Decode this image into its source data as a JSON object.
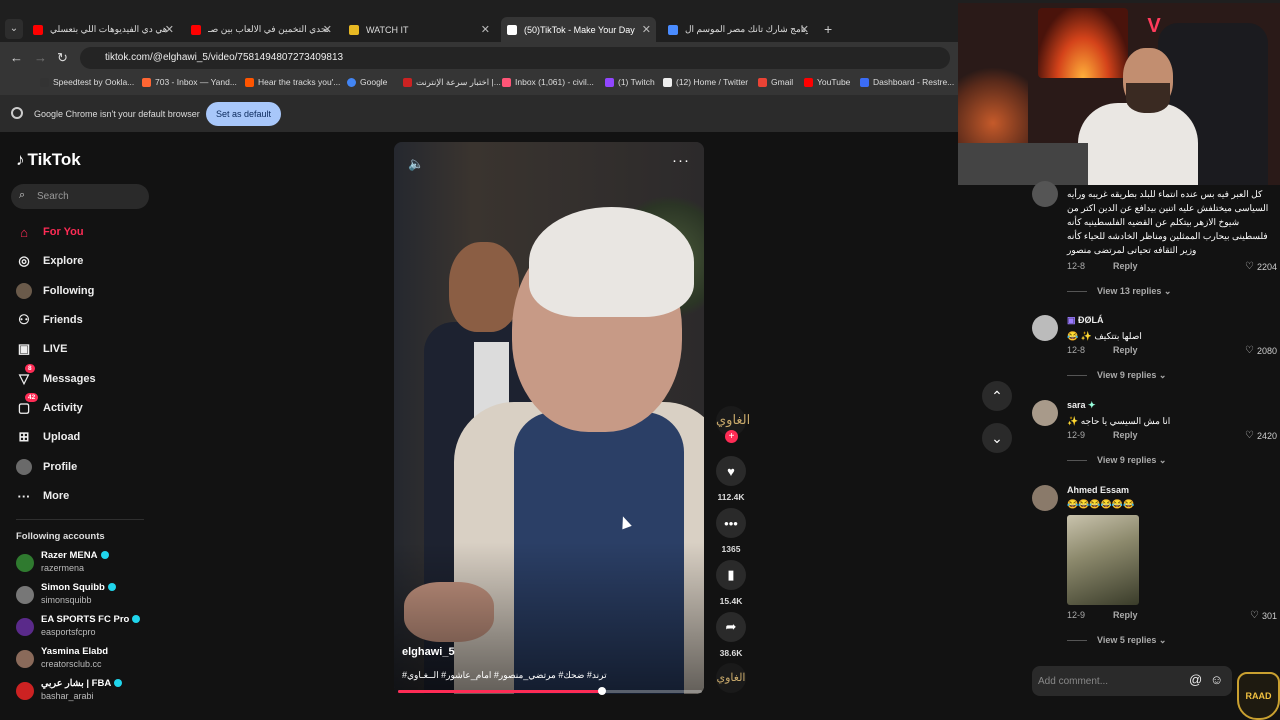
{
  "browser": {
    "tabs": [
      {
        "title": "هي دي الفيديوهات اللي بتعسلي",
        "color": "#ff0000"
      },
      {
        "title": "تحدي التخمين في الالعاب بين صـ",
        "color": "#ff0000"
      },
      {
        "title": "WATCH IT",
        "color": "#e8b923"
      },
      {
        "title": "(50)TikTok - Make Your Day",
        "color": "#ffffff",
        "active": true
      },
      {
        "title": "برنامج شارك تانك مصر الموسم ال",
        "color": "#4a8cff"
      }
    ],
    "url": "tiktok.com/@elghawi_5/video/7581494807273409813",
    "bookmarks": [
      {
        "label": "Speedtest by Ookla...",
        "color": "#333333"
      },
      {
        "label": "703 - Inbox — Yand...",
        "color": "#ff6633"
      },
      {
        "label": "Hear the tracks you'...",
        "color": "#ff5500"
      },
      {
        "label": "Google",
        "color": "#4285f4"
      },
      {
        "label": "اختبار سرعة الإنترنت |...",
        "color": "#cc2222"
      },
      {
        "label": "Inbox (1,061) - civil...",
        "color": "#ff5577"
      },
      {
        "label": "(1) Twitch",
        "color": "#9146ff"
      },
      {
        "label": "(12) Home / Twitter",
        "color": "#eeeeee"
      },
      {
        "label": "Gmail",
        "color": "#ea4335"
      },
      {
        "label": "YouTube",
        "color": "#ff0000"
      },
      {
        "label": "Dashboard - Restre...",
        "color": "#3b6cf5"
      }
    ],
    "infobar": {
      "message": "Google Chrome isn't your default browser",
      "button": "Set as default"
    }
  },
  "sidebar": {
    "logo": "TikTok",
    "search_placeholder": "Search",
    "nav": [
      {
        "label": "For You",
        "icon": "home-icon",
        "active": true
      },
      {
        "label": "Explore",
        "icon": "compass-icon"
      },
      {
        "label": "Following",
        "icon": "following-icon"
      },
      {
        "label": "Friends",
        "icon": "friends-icon"
      },
      {
        "label": "LIVE",
        "icon": "live-icon"
      },
      {
        "label": "Messages",
        "icon": "messages-icon",
        "badge": "8"
      },
      {
        "label": "Activity",
        "icon": "activity-icon",
        "badge": "42"
      },
      {
        "label": "Upload",
        "icon": "upload-icon"
      },
      {
        "label": "Profile",
        "icon": "profile-icon"
      },
      {
        "label": "More",
        "icon": "more-icon"
      }
    ],
    "following_title": "Following accounts",
    "accounts": [
      {
        "name": "Razer MENA",
        "handle": "razermena",
        "verified": true,
        "color": "#2f7a2f"
      },
      {
        "name": "Simon Squibb",
        "handle": "simonsquibb",
        "verified": true,
        "color": "#777777"
      },
      {
        "name": "EA SPORTS FC Pro",
        "handle": "easportsfcpro",
        "verified": true,
        "color": "#5a2a8a"
      },
      {
        "name": "Yasmina Elabd",
        "handle": "creatorsclub.cc",
        "verified": false,
        "color": "#8a6a5a"
      },
      {
        "name": "بشار عربي | FBA",
        "handle": "bashar_arabi",
        "verified": true,
        "color": "#cc2222"
      }
    ]
  },
  "video": {
    "username": "elghawi_5",
    "caption": "ترند# ضحك# مرتضي_منصور# امام_عاشور# الــغـاوي#",
    "progress": 0.67,
    "avatar_text": "الغاوي",
    "likes": "112.4K",
    "comments": "1365",
    "saves": "15.4K",
    "shares": "38.6K"
  },
  "comments": [
    {
      "name": "",
      "text": "كل العبر فيه بس عنده انتماء للبلد بطريقه غريبه ورأيه السياسى ميختلفش عليه اتنين بيدافع عن الدين اكتر من شيوخ الازهر بيتكلم عن القضيه الفلسطينيه كأنه فلسطينى بيحارب الممثلين ومناظر الخادشه للحياء كأنه وزير الثقافه تحياتى لمرتضى منصور",
      "date": "12-8",
      "reply": "Reply",
      "likes": "2204",
      "replies": "View 13 replies",
      "color": "#555555"
    },
    {
      "name": "ÐØLÁ",
      "text": "اصلها بتتكيف ✨ 😂",
      "date": "12-8",
      "reply": "Reply",
      "likes": "2080",
      "replies": "View 9 replies",
      "color": "#bbbbbb"
    },
    {
      "name": "sara",
      "text": "انا مش السيسي يا حاجه ✨",
      "date": "12-9",
      "reply": "Reply",
      "likes": "2420",
      "replies": "View 9 replies",
      "color": "#a89a8a"
    },
    {
      "name": "Ahmed Essam",
      "text": "😂😂😂😂😂😂",
      "date": "12-9",
      "reply": "Reply",
      "likes": "301",
      "replies": "View 5 replies",
      "color": "#8a7a6a"
    }
  ],
  "add_comment_placeholder": "Add comment...",
  "add_comment_at": "@",
  "raad_logo": "RAAD"
}
